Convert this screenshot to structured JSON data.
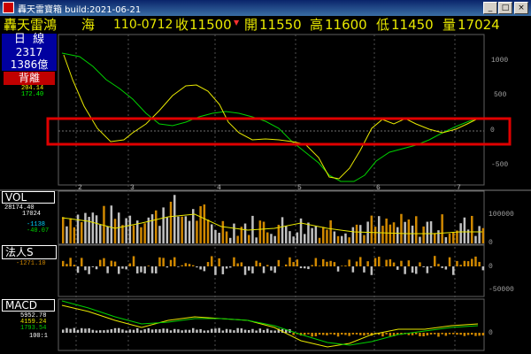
{
  "window": {
    "title": "轟天雷寶箱 build:2021-06-21"
  },
  "info": {
    "name": "轟天雷鴻",
    "market": "海",
    "contract": "110-0712",
    "close_label": "收",
    "close_value": "11500",
    "open_label": "開",
    "open_value": "11550",
    "high_label": "高",
    "high_value": "11600",
    "low_label": "低",
    "low_value": "11450",
    "vol_label": "量",
    "vol_value": "17024"
  },
  "side": {
    "period": "日  線",
    "code": "2317",
    "cap": "1386億",
    "tag": "背離",
    "val1": "204.14",
    "val2": "172.40"
  },
  "vol_panel": {
    "label": "VOL",
    "v1": "28174.40",
    "v2": "17024",
    "v3": "-1138",
    "v4": "-40.07"
  },
  "inst_panel": {
    "label": "法人S",
    "v1": "-1271.10"
  },
  "macd_panel": {
    "label": "MACD",
    "v1": "5952.78",
    "v2": "4159.24",
    "v3": "1793.54",
    "v4": "100:1"
  },
  "axes": {
    "main_ticks": [
      "1000",
      "500",
      "0",
      "-500"
    ],
    "vol_ticks": [
      "100000",
      "0"
    ],
    "inst_ticks": [
      "0",
      "-50000"
    ],
    "macd_ticks": [
      "0"
    ],
    "months": [
      "2",
      "3",
      "4",
      "5",
      "6",
      "7"
    ]
  },
  "colors": {
    "highlight": "#e00000",
    "yellow": "#e8e800",
    "green": "#00d000",
    "orange": "#d08800"
  }
}
